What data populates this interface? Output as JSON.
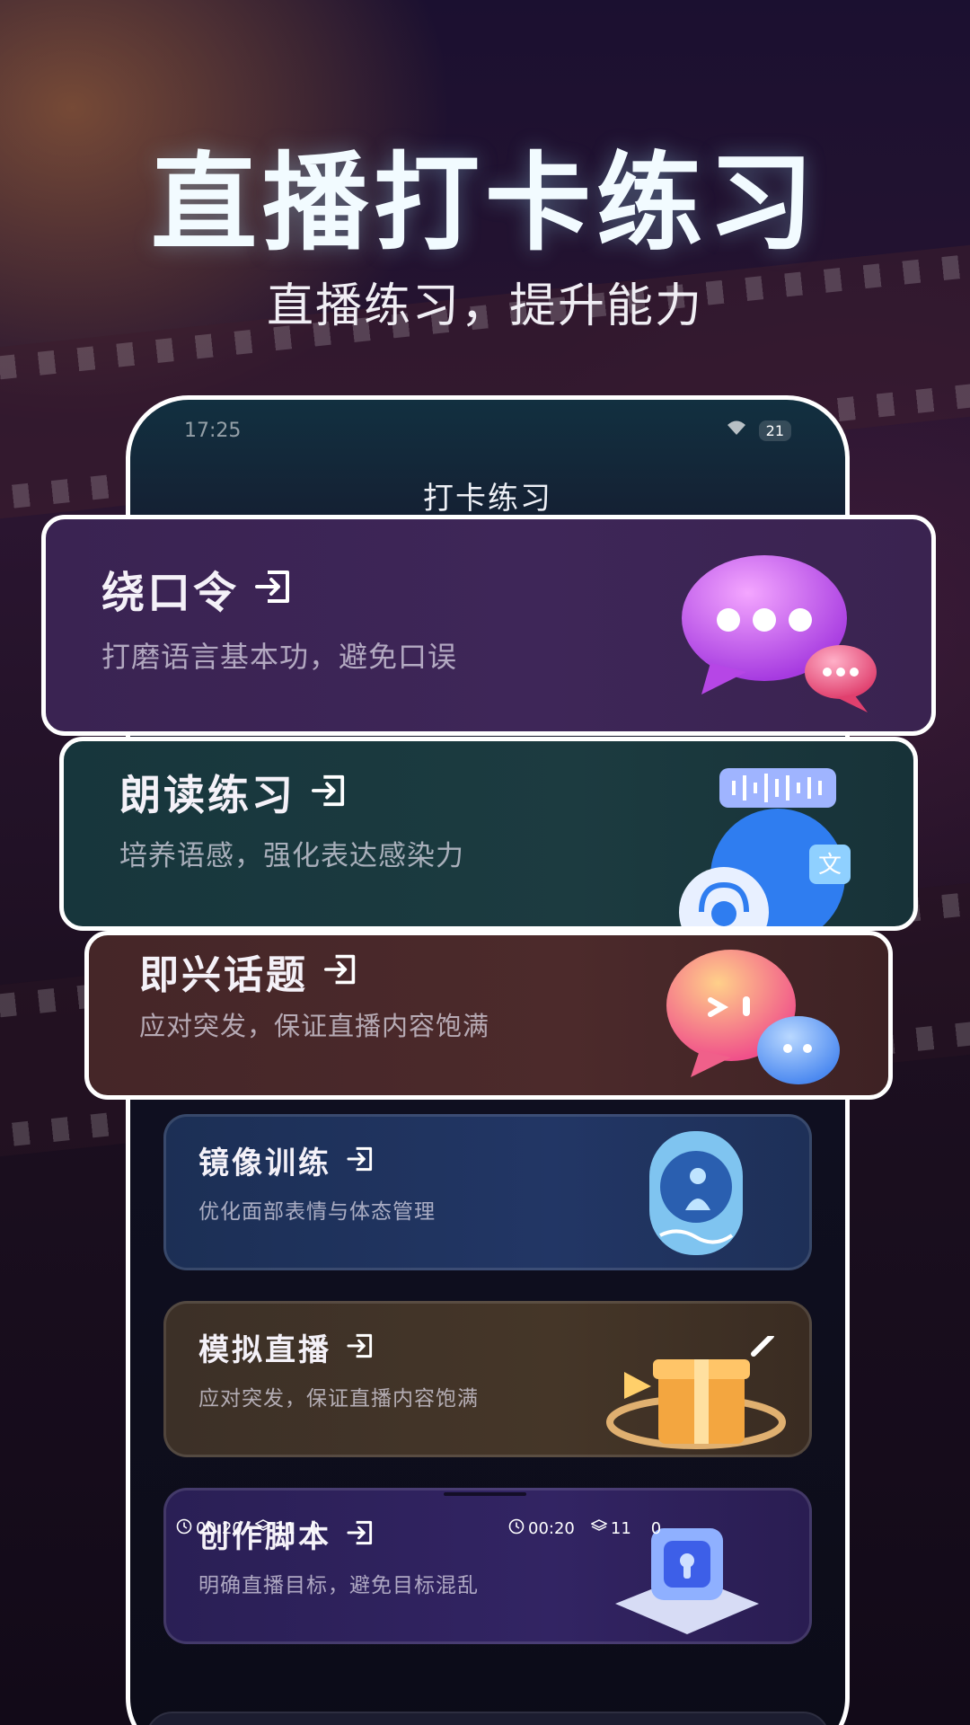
{
  "hero": {
    "title": "直播打卡练习",
    "subtitle": "直播练习，提升能力"
  },
  "phone": {
    "status_time": "17:25",
    "battery": "21",
    "page_title": "打卡练习"
  },
  "cards": [
    {
      "title": "绕口令",
      "desc": "打磨语言基本功，避免口误",
      "icon": "chat-bubbles-icon"
    },
    {
      "title": "朗读练习",
      "desc": "培养语感，强化表达感染力",
      "icon": "headset-audio-icon"
    },
    {
      "title": "即兴话题",
      "desc": "应对突发，保证直播内容饱满",
      "icon": "emoji-bubbles-icon"
    },
    {
      "title": "镜像训练",
      "desc": "优化面部表情与体态管理",
      "icon": "mirror-icon"
    },
    {
      "title": "模拟直播",
      "desc": "应对突发，保证直播内容饱满",
      "icon": "gift-box-icon"
    },
    {
      "title": "创作脚本",
      "desc": "明确直播目标，避免目标混乱",
      "icon": "crystal-cube-icon"
    }
  ],
  "overlay": {
    "left_time": "00:20",
    "left_count": "11",
    "left_zero": "0",
    "right_time": "00:20",
    "right_count": "11",
    "right_zero": "0"
  },
  "colors": {
    "hero_title": "#f2fbff",
    "card1_bg": "#3e2658",
    "card2_bg": "#1c3b40",
    "card3_bg": "#4c2a2b",
    "card4_bg": "#223665",
    "card5_bg": "#453628",
    "card6_bg": "#322463"
  }
}
